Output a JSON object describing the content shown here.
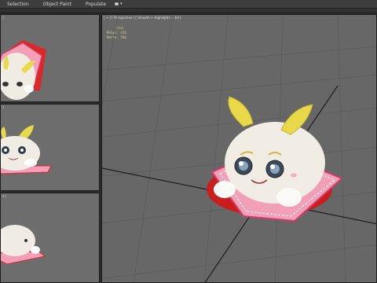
{
  "menubar": {
    "items": [
      {
        "label": "Selection"
      },
      {
        "label": "Object Paint"
      },
      {
        "label": "Populate"
      }
    ]
  },
  "viewports": {
    "top": {
      "label": "]"
    },
    "front": {
      "label": "}"
    },
    "left": {
      "label": "e ]"
    },
    "perspective": {
      "label": "[ + ] [ Perspective ] [ Smooth + Highlights + Ed ]",
      "stats": {
        "title": "Total",
        "polys_label": "Polys:",
        "polys_value": "620",
        "verts_label": "Verts:",
        "verts_value": "580"
      }
    }
  },
  "colors": {
    "body": "#f0ece4",
    "leaf": "#e8d84a",
    "cushion_pink": "#f2a0b8",
    "cushion_base": "#d82a2a"
  }
}
